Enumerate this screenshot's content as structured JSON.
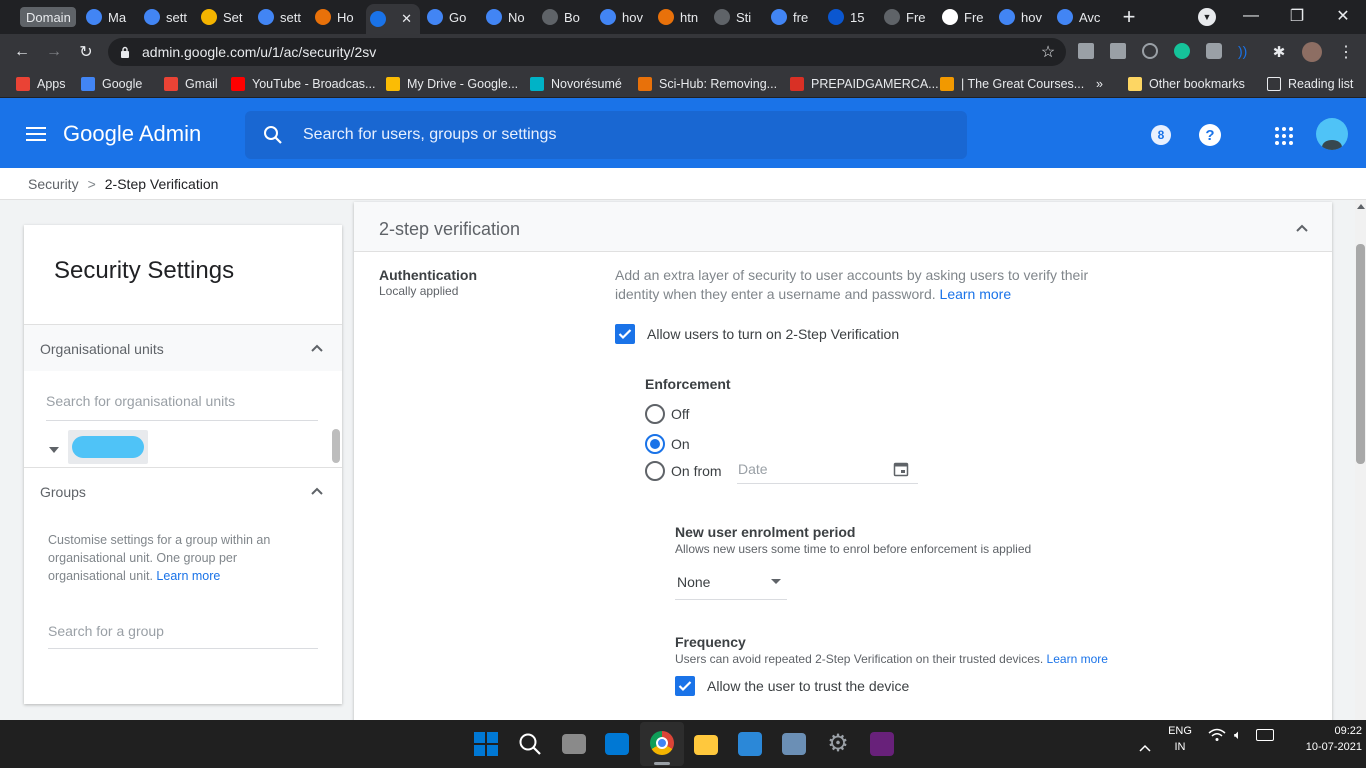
{
  "browser": {
    "tabs": [
      {
        "label": "Domain",
        "color": "#9aa0a6"
      },
      {
        "label": "Ma",
        "color": "#4285f4"
      },
      {
        "label": "sett",
        "color": "#4285f4"
      },
      {
        "label": "Set",
        "color": "#f4b400"
      },
      {
        "label": "sett",
        "color": "#4285f4"
      },
      {
        "label": "Ho",
        "color": "#e8710a"
      },
      {
        "label": "",
        "color": "#1a73e8",
        "active": true
      },
      {
        "label": "Go",
        "color": "#4285f4"
      },
      {
        "label": "No",
        "color": "#4285f4"
      },
      {
        "label": "Bo",
        "color": "#5f6368"
      },
      {
        "label": "hov",
        "color": "#4285f4"
      },
      {
        "label": "htn",
        "color": "#e8710a"
      },
      {
        "label": "Sti",
        "color": "#5f6368"
      },
      {
        "label": "fre",
        "color": "#4285f4"
      },
      {
        "label": "15",
        "color": "#0b57d0"
      },
      {
        "label": "Fre",
        "color": "#5f6368"
      },
      {
        "label": "Fre",
        "color": "#ffffff"
      },
      {
        "label": "hov",
        "color": "#4285f4"
      },
      {
        "label": "Avc",
        "color": "#4285f4"
      }
    ],
    "url": "admin.google.com/u/1/ac/security/2sv",
    "bookmarks": [
      {
        "label": "Apps",
        "color": "#ea4335"
      },
      {
        "label": "Google",
        "color": "#4285f4"
      },
      {
        "label": "Gmail",
        "color": "#ea4335"
      },
      {
        "label": "YouTube - Broadcas...",
        "color": "#ff0000"
      },
      {
        "label": "My Drive - Google...",
        "color": "#fbbc04"
      },
      {
        "label": "Novorésumé",
        "color": "#00b3c7"
      },
      {
        "label": "Sci-Hub: Removing...",
        "color": "#e8710a"
      },
      {
        "label": "PREPAIDGAMERCA...",
        "color": "#d93025"
      },
      {
        "label": "| The Great Courses...",
        "color": "#f29900"
      },
      {
        "label": "»",
        "color": ""
      },
      {
        "label": "Other bookmarks",
        "color": "#fdd663"
      },
      {
        "label": "Reading list",
        "color": ""
      }
    ]
  },
  "admin": {
    "app_name": "Google Admin",
    "search_placeholder": "Search for users, groups or settings",
    "notification_count": "8",
    "breadcrumb": {
      "parent": "Security",
      "separator": ">",
      "current": "2-Step Verification"
    }
  },
  "sidebar": {
    "title": "Security Settings",
    "org_units": {
      "heading": "Organisational units",
      "search_placeholder": "Search for organisational units"
    },
    "groups": {
      "heading": "Groups",
      "description": "Customise settings for a group within an organisational unit. One group per organisational unit.",
      "learn_more": "Learn more",
      "search_placeholder": "Search for a group"
    }
  },
  "main": {
    "section_title": "2-step verification",
    "authentication": {
      "label": "Authentication",
      "sublabel": "Locally applied",
      "description": "Add an extra layer of security to user accounts by asking users to verify their identity when they enter a username and password.",
      "learn_more": "Learn more",
      "allow_checkbox_label": "Allow users to turn on 2-Step Verification",
      "allow_checked": true
    },
    "enforcement": {
      "heading": "Enforcement",
      "options": [
        "Off",
        "On",
        "On from"
      ],
      "selected": "On",
      "date_placeholder": "Date"
    },
    "enrolment": {
      "heading": "New user enrolment period",
      "description": "Allows new users some time to enrol before enforcement is applied",
      "value": "None"
    },
    "frequency": {
      "heading": "Frequency",
      "description": "Users can avoid repeated 2-Step Verification on their trusted devices.",
      "learn_more": "Learn more",
      "trust_label": "Allow the user to trust the device",
      "trust_checked": true
    }
  },
  "taskbar": {
    "language": "ENG",
    "region": "IN",
    "time": "09:22",
    "date": "10-07-2021"
  }
}
